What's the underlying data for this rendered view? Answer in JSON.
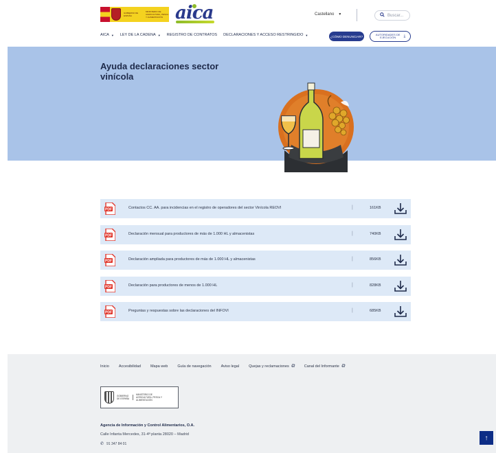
{
  "header": {
    "gov_text": "GOBIERNO DE ESPAÑA",
    "ministry_text": "MINISTERIO DE AGRICULTURA, PESCA Y ALIMENTACIÓN",
    "brand": "aica",
    "language": "Castellano",
    "search_placeholder": "Buscar...",
    "nav": [
      {
        "label": "AICA",
        "dropdown": true
      },
      {
        "label": "LEY DE LA CADENA",
        "dropdown": true
      },
      {
        "label": "REGISTRO DE CONTRATOS",
        "dropdown": false
      },
      {
        "label": "DECLARACIONES Y ACCESO RESTRINGIDO",
        "dropdown": true
      }
    ],
    "denunciar_label": "¿CÓMO DENUNCIAR?",
    "autoridades_label": "AUTORIDADES DE EJECUCIÓN"
  },
  "hero": {
    "title": "Ayuda declaraciones sector vinícola"
  },
  "documents": [
    {
      "title": "Contactos CC. AA. para incidencias en el registro de operadores del sector Vinícola REOVI",
      "size": "161KB"
    },
    {
      "title": "Declaración mensual para productores de más de 1.000 HL y almacenistas",
      "size": "740KB"
    },
    {
      "title": "Declaración ampliada para productores de más de 1.000 HL y almacenistas",
      "size": "856KB"
    },
    {
      "title": "Declaración para productores de menos de 1.000 HL",
      "size": "828KB"
    },
    {
      "title": "Preguntas y respuestas sobre las declaraciones del INFOVI",
      "size": "685KB"
    }
  ],
  "footer": {
    "links": [
      {
        "label": "Inicio",
        "external": false
      },
      {
        "label": "Accesibilidad",
        "external": false
      },
      {
        "label": "Mapa web",
        "external": false
      },
      {
        "label": "Guía de navegación",
        "external": false
      },
      {
        "label": "Aviso legal",
        "external": false
      },
      {
        "label": "Quejas y reclamaciones",
        "external": true
      },
      {
        "label": "Canal del Informante",
        "external": true
      }
    ],
    "gov_text": "GOBIERNO DE ESPAÑA",
    "ministry_text": "MINISTERIO DE AGRICULTURA, PESCA Y ALIMENTACIÓN",
    "org_name": "Agencia de Información y Control Alimentarios, O.A.",
    "address": "Calle Infanta Mercedes, 31-4ª planta 28020 – Madrid",
    "phone": "91 347 84 01"
  },
  "colors": {
    "hero_bg": "#a9c3e8",
    "doc_row_bg": "#dde9f7",
    "primary": "#273c8f",
    "footer_bg": "#eef0f2",
    "pdf_red": "#e0362b"
  },
  "icons": {
    "search": "magnifier-icon",
    "download": "download-icon",
    "pdf": "pdf-file-icon",
    "external": "external-link-icon",
    "phone": "phone-icon",
    "back_to_top": "arrow-up-icon"
  }
}
